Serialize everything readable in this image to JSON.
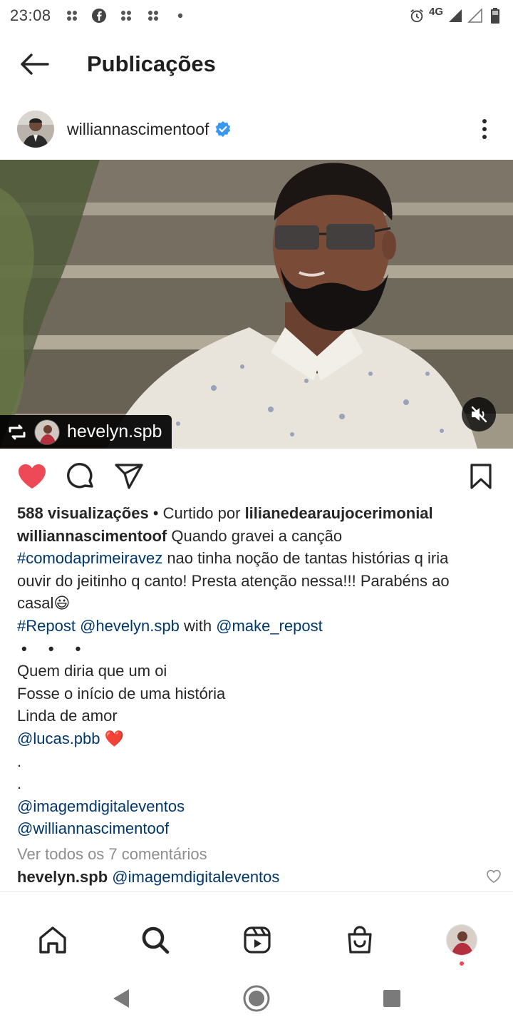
{
  "status_bar": {
    "time": "23:08",
    "left_icons": [
      "notification-icon",
      "facebook-icon",
      "notification-icon",
      "notification-icon",
      "dot-icon"
    ],
    "right_icons": [
      "alarm-icon",
      "signal-icon",
      "signal-icon",
      "battery-icon"
    ],
    "network": "4G"
  },
  "header": {
    "title": "Publicações",
    "back_icon": "arrow-left-icon"
  },
  "post": {
    "username": "williannascimentoof",
    "verified": true,
    "more_icon": "more-vertical-icon",
    "repost_username": "hevelyn.spb",
    "liked": true,
    "stats": {
      "views": "588 visualizações",
      "liked_by_prefix": " • Curtido por ",
      "liked_by_user": "lilianedearaujocerimonial"
    },
    "caption": {
      "author": "williannascimentoof",
      "text1": " Quando gravei a canção",
      "hashtag1": "#comodaprimeiravez",
      "text2": " nao tinha noção de tantas histórias q iria",
      "line3": "ouvir do jeitinho q canto! Presta atenção nessa!!! Parabéns ao",
      "line4": "casal😃",
      "repost_hashtag": "#Repost",
      "repost_mention": "@hevelyn.spb",
      "repost_with": " with ",
      "repost_app": "@make_repost",
      "dots": "• • •",
      "quote1": "Quem diria que um oi",
      "quote2": "Fosse o início de uma história",
      "quote3": "Linda de amor",
      "mention_lucas": "@lucas.pbb",
      "heart_emoji": "❤️",
      "period1": ".",
      "period2": ".",
      "mention_imagem": "@imagemdigitaleventos",
      "mention_willian": "@williannascimentoof"
    },
    "view_comments": "Ver todos os 7 comentários",
    "comment": {
      "user": "hevelyn.spb",
      "text": "@imagemdigitaleventos"
    }
  },
  "colors": {
    "like_red": "#ed4956",
    "link_blue": "#00376b",
    "verified_blue": "#3897f0",
    "muted_gray": "#8e8e8e"
  },
  "bottom_nav": [
    "home-icon",
    "search-icon",
    "reels-icon",
    "shop-icon",
    "profile-avatar"
  ],
  "system_nav": [
    "back-triangle-icon",
    "home-circle-icon",
    "recents-square-icon"
  ]
}
